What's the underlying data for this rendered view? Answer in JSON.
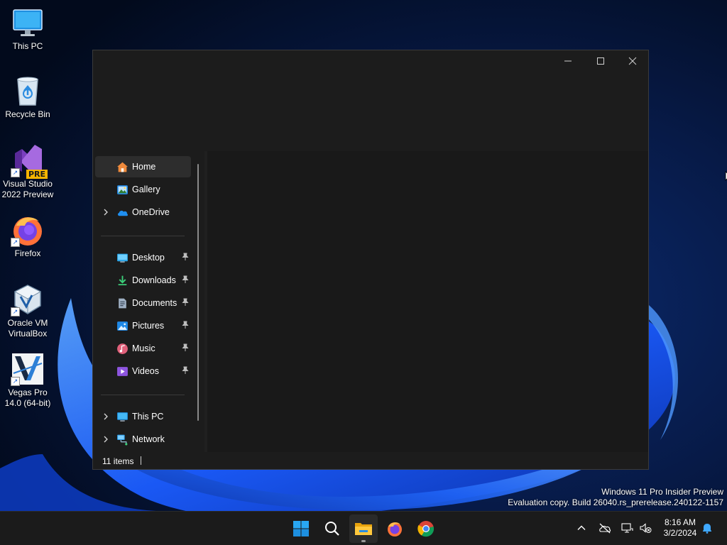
{
  "desktop": {
    "icons": [
      {
        "label_line1": "This PC",
        "label_line2": "",
        "icon": "monitor-icon"
      },
      {
        "label_line1": "Recycle Bin",
        "label_line2": "",
        "icon": "recycle-bin-icon"
      },
      {
        "label_line1": "Visual Studio",
        "label_line2": "2022 Preview",
        "icon": "visual-studio-icon",
        "badge": "PRE"
      },
      {
        "label_line1": "Firefox",
        "label_line2": "",
        "icon": "firefox-icon"
      },
      {
        "label_line1": "Oracle VM",
        "label_line2": "VirtualBox",
        "icon": "virtualbox-icon"
      },
      {
        "label_line1": "Vegas Pro",
        "label_line2": "14.0 (64-bit)",
        "icon": "vegas-pro-icon"
      }
    ]
  },
  "explorer": {
    "nav": {
      "top": [
        {
          "label": "Home",
          "icon": "home-icon",
          "selected": true
        },
        {
          "label": "Gallery",
          "icon": "gallery-icon"
        },
        {
          "label": "OneDrive",
          "icon": "onedrive-icon",
          "expandable": true
        }
      ],
      "quick_access": [
        {
          "label": "Desktop",
          "icon": "desktop-folder-icon"
        },
        {
          "label": "Downloads",
          "icon": "downloads-icon"
        },
        {
          "label": "Documents",
          "icon": "documents-icon"
        },
        {
          "label": "Pictures",
          "icon": "pictures-icon"
        },
        {
          "label": "Music",
          "icon": "music-icon"
        },
        {
          "label": "Videos",
          "icon": "videos-icon"
        }
      ],
      "bottom": [
        {
          "label": "This PC",
          "icon": "this-pc-icon",
          "expandable": true
        },
        {
          "label": "Network",
          "icon": "network-icon",
          "expandable": true
        }
      ]
    },
    "status": {
      "item_count": "11 items"
    }
  },
  "watermark": {
    "line1": "Windows 11 Pro Insider Preview",
    "line2": "Evaluation copy. Build 26040.rs_prerelease.240122-1157"
  },
  "taskbar": {
    "apps": [
      "start-icon",
      "search-icon",
      "file-explorer-icon",
      "firefox-icon",
      "chrome-icon"
    ],
    "tray": [
      "chevron-up-icon",
      "onedrive-offline-icon",
      "network-icon",
      "volume-muted-icon"
    ],
    "clock": {
      "time": "8:16 AM",
      "date": "3/2/2024"
    }
  },
  "colors": {
    "window_bg": "#1c1c1c",
    "content_bg": "#191919",
    "taskbar_bg": "#1b1b1b",
    "accent": "#0078d4"
  }
}
